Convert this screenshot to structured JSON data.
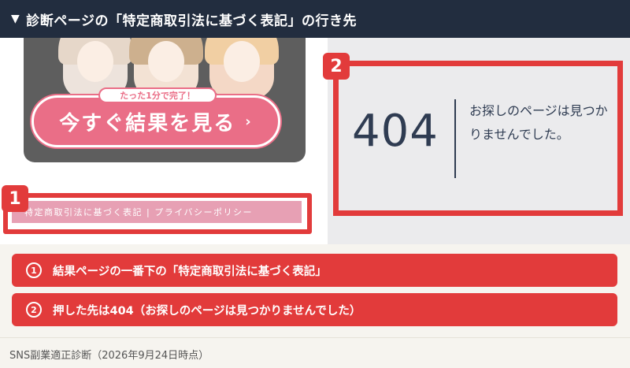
{
  "header": {
    "title": "診断ページの「特定商取引法に基づく表記」の行き先"
  },
  "left_screen": {
    "banner": {
      "pill_text": "たった1分で完了！",
      "cta_label": "今すぐ結果を見る",
      "cta_arrow": "›"
    },
    "footer_links": "特定商取引法に基づく表記 | プライバシーポリシー"
  },
  "right_screen": {
    "error_code": "404",
    "error_message": "お探しのページは見つかりませんでした。"
  },
  "markers": {
    "one": "1",
    "two": "2"
  },
  "notes": [
    {
      "num": "1",
      "text": "結果ページの一番下の「特定商取引法に基づく表記」"
    },
    {
      "num": "2",
      "text": "押した先は404（お探しのページは見つかりませんでした）"
    }
  ],
  "source": "SNS副業適正診断（2026年9月24日時点）",
  "colors": {
    "header_bg": "#222d3f",
    "highlight_red": "#e23b3b",
    "cta_pink": "#ea6e87"
  }
}
